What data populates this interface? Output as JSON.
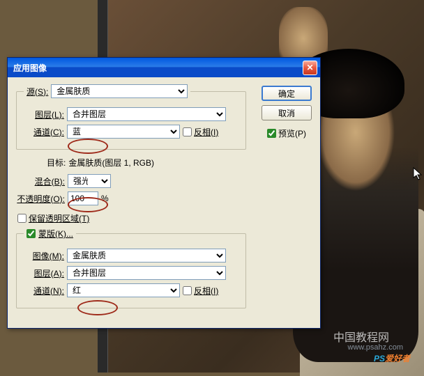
{
  "dialog": {
    "title": "应用图像",
    "source": {
      "legend_label": "源(S):",
      "legend_value": "金属肤质",
      "layer_label": "图层(L):",
      "layer_value": "合并图层",
      "channel_label": "通道(C):",
      "channel_value": "蓝",
      "invert_label": "反相(I)"
    },
    "target": {
      "label": "目标:",
      "value": "金属肤质(图层 1, RGB)"
    },
    "blend": {
      "label": "混合(B):",
      "value": "强光"
    },
    "opacity": {
      "label": "不透明度(O):",
      "value": "100",
      "suffix": "%"
    },
    "preserve_trans_label": "保留透明区域(T)",
    "mask": {
      "legend_label": "蒙版(K)...",
      "image_label": "图像(M):",
      "image_value": "金属肤质",
      "layer_label": "图层(A):",
      "layer_value": "合并图层",
      "channel_label": "通道(N):",
      "channel_value": "红",
      "invert_label": "反相(I)"
    },
    "buttons": {
      "ok": "确定",
      "cancel": "取消",
      "preview": "预览(P)"
    }
  },
  "watermarks": {
    "w1": "中国教程网",
    "w2_ps": "PS",
    "w2_rest": "爱好者",
    "w3": "www.psahz.com"
  }
}
